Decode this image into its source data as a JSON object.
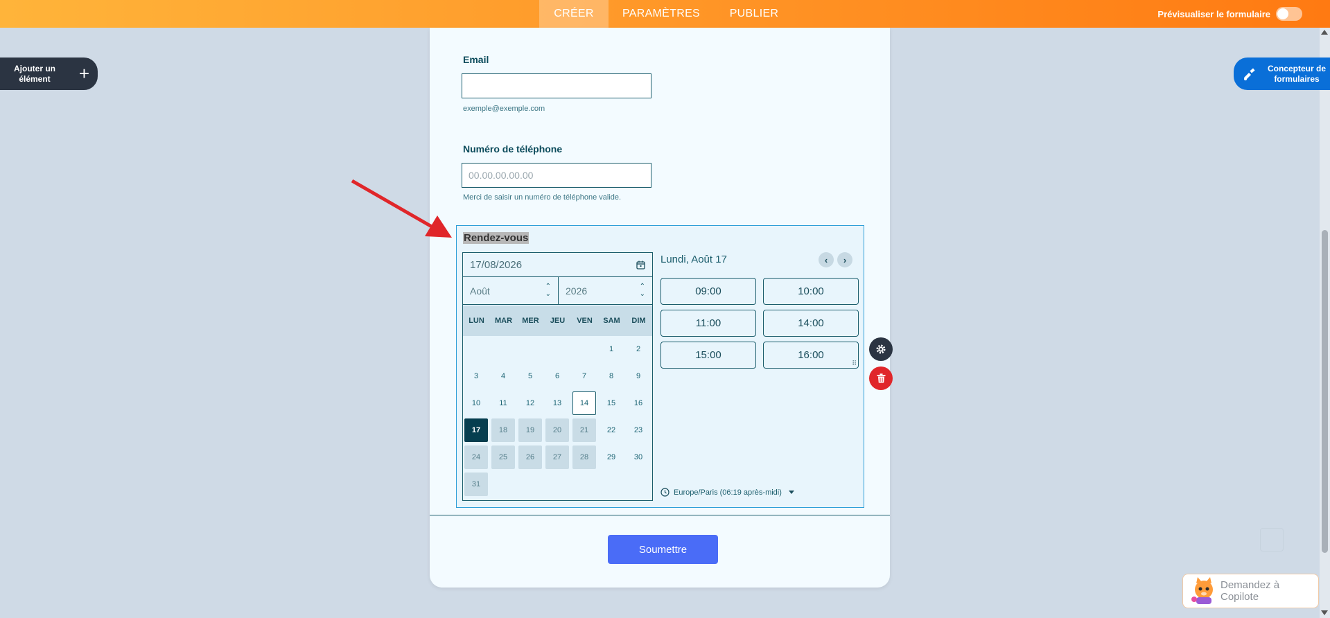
{
  "topbar": {
    "tabs": [
      {
        "label": "CRÉER",
        "active": true
      },
      {
        "label": "PARAMÈTRES",
        "active": false
      },
      {
        "label": "PUBLIER",
        "active": false
      }
    ],
    "preview_label": "Prévisualiser le formulaire",
    "preview_on": false
  },
  "left_panel": {
    "add_element_label": "Ajouter un élément"
  },
  "right_panel": {
    "designer_label": "Concepteur de formulaires"
  },
  "form": {
    "email": {
      "label": "Email",
      "value": "",
      "hint": "exemple@exemple.com"
    },
    "phone": {
      "label": "Numéro de téléphone",
      "placeholder": "00.00.00.00.00",
      "hint": "Merci de saisir un numéro de téléphone valide."
    },
    "appointment": {
      "label": "Rendez-vous",
      "date_value": "17/08/2026",
      "month": "Août",
      "year": "2026",
      "weekdays": [
        "LUN",
        "MAR",
        "MER",
        "JEU",
        "VEN",
        "SAM",
        "DIM"
      ],
      "weeks": [
        [
          null,
          null,
          null,
          null,
          null,
          1,
          2
        ],
        [
          3,
          4,
          5,
          6,
          7,
          8,
          9
        ],
        [
          10,
          11,
          12,
          13,
          14,
          15,
          16
        ],
        [
          17,
          18,
          19,
          20,
          21,
          22,
          23
        ],
        [
          24,
          25,
          26,
          27,
          28,
          29,
          30
        ],
        [
          31,
          null,
          null,
          null,
          null,
          null,
          null
        ]
      ],
      "selected_day": 17,
      "today_day": 14,
      "unavailable_days": [
        18,
        19,
        20,
        21,
        24,
        25,
        26,
        27,
        28,
        31
      ],
      "slots_heading": "Lundi, Août 17",
      "slots": [
        "09:00",
        "10:00",
        "11:00",
        "14:00",
        "15:00",
        "16:00"
      ],
      "timezone": "Europe/Paris (06:19 après-midi)"
    },
    "submit_label": "Soumettre"
  },
  "copilot": {
    "label": "Demandez à Copilote"
  },
  "colors": {
    "accent": "#ff7a12",
    "submit": "#4a6cf7",
    "selected_day": "#063e4f",
    "delete": "#e0262a"
  }
}
